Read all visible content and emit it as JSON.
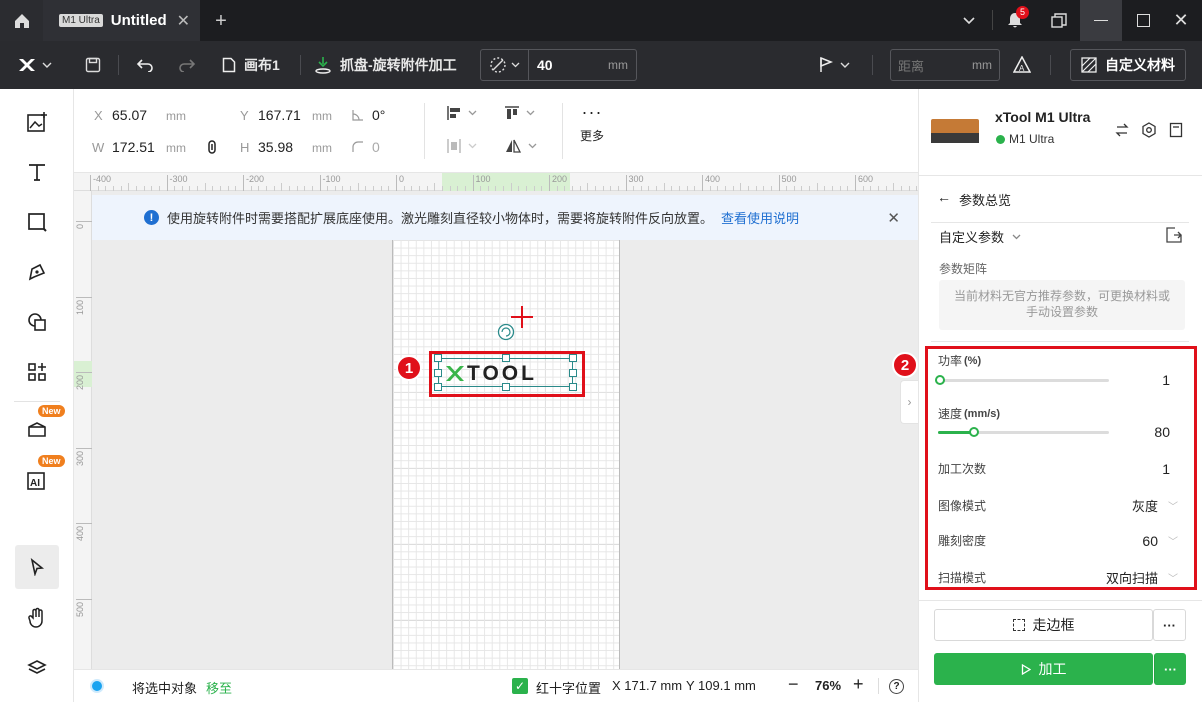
{
  "titlebar": {
    "home_icon": "home-icon",
    "tab_badge": "M1 Ultra",
    "tab_title": "Untitled",
    "notification_count": "5"
  },
  "toolbar": {
    "canvas_name": "画布1",
    "mode_label": "抓盘-旋转附件加工",
    "diameter_value": "40",
    "diameter_unit": "mm",
    "distance_placeholder": "距离",
    "distance_unit": "mm",
    "custom_material_label": "自定义材料"
  },
  "sidebar": {
    "new_badge_1": "New",
    "new_badge_2": "New"
  },
  "props": {
    "x_label": "X",
    "x_value": "65.07",
    "x_unit": "mm",
    "y_label": "Y",
    "y_value": "167.71",
    "y_unit": "mm",
    "rotation_value": "0°",
    "w_label": "W",
    "w_value": "172.51",
    "w_unit": "mm",
    "h_label": "H",
    "h_value": "35.98",
    "h_unit": "mm",
    "corner_value": "0",
    "more_label": "更多"
  },
  "ruler": {
    "h_ticks": [
      "-400",
      "-300",
      "-200",
      "-100",
      "0",
      "100",
      "200",
      "300",
      "400",
      "500",
      "600"
    ],
    "v_ticks": [
      "0",
      "100",
      "200",
      "300",
      "400",
      "500"
    ]
  },
  "notice": {
    "text": "使用旋转附件时需要搭配扩展底座使用。激光雕刻直径较小物体时，需要将旋转附件反向放置。",
    "link": "查看使用说明"
  },
  "canvas": {
    "logo_text": "TOOL",
    "marker1": "1",
    "marker2": "2"
  },
  "statusbar": {
    "move_prefix": "将选中对象",
    "move_link": "移至",
    "crosshair_label": "红十字位置",
    "x_coord": "X 171.7 mm",
    "y_coord": "Y 109.1 mm",
    "zoom": "76%"
  },
  "device": {
    "name": "xTool M1 Ultra",
    "model": "M1 Ultra",
    "status_color": "#2bb24c"
  },
  "params": {
    "back_label": "参数总览",
    "custom_params": "自定义参数",
    "matrix_label": "参数矩阵",
    "matrix_hint": "当前材料无官方推荐参数，可更换材料或手动设置参数",
    "power_label": "功率",
    "power_unit": "(%)",
    "power_value": "1",
    "power_fraction": 0.01,
    "speed_label": "速度",
    "speed_unit": "(mm/s)",
    "speed_value": "80",
    "speed_fraction": 0.21,
    "passes_label": "加工次数",
    "passes_value": "1",
    "image_mode_label": "图像模式",
    "image_mode_value": "灰度",
    "density_label": "雕刻密度",
    "density_value": "60",
    "scan_mode_label": "扫描模式",
    "scan_mode_value": "双向扫描"
  },
  "actions": {
    "frame_label": "走边框",
    "process_label": "加工"
  },
  "colors": {
    "accent": "#2bb24c",
    "marker": "#e0101a",
    "link": "#1f6fd1"
  }
}
